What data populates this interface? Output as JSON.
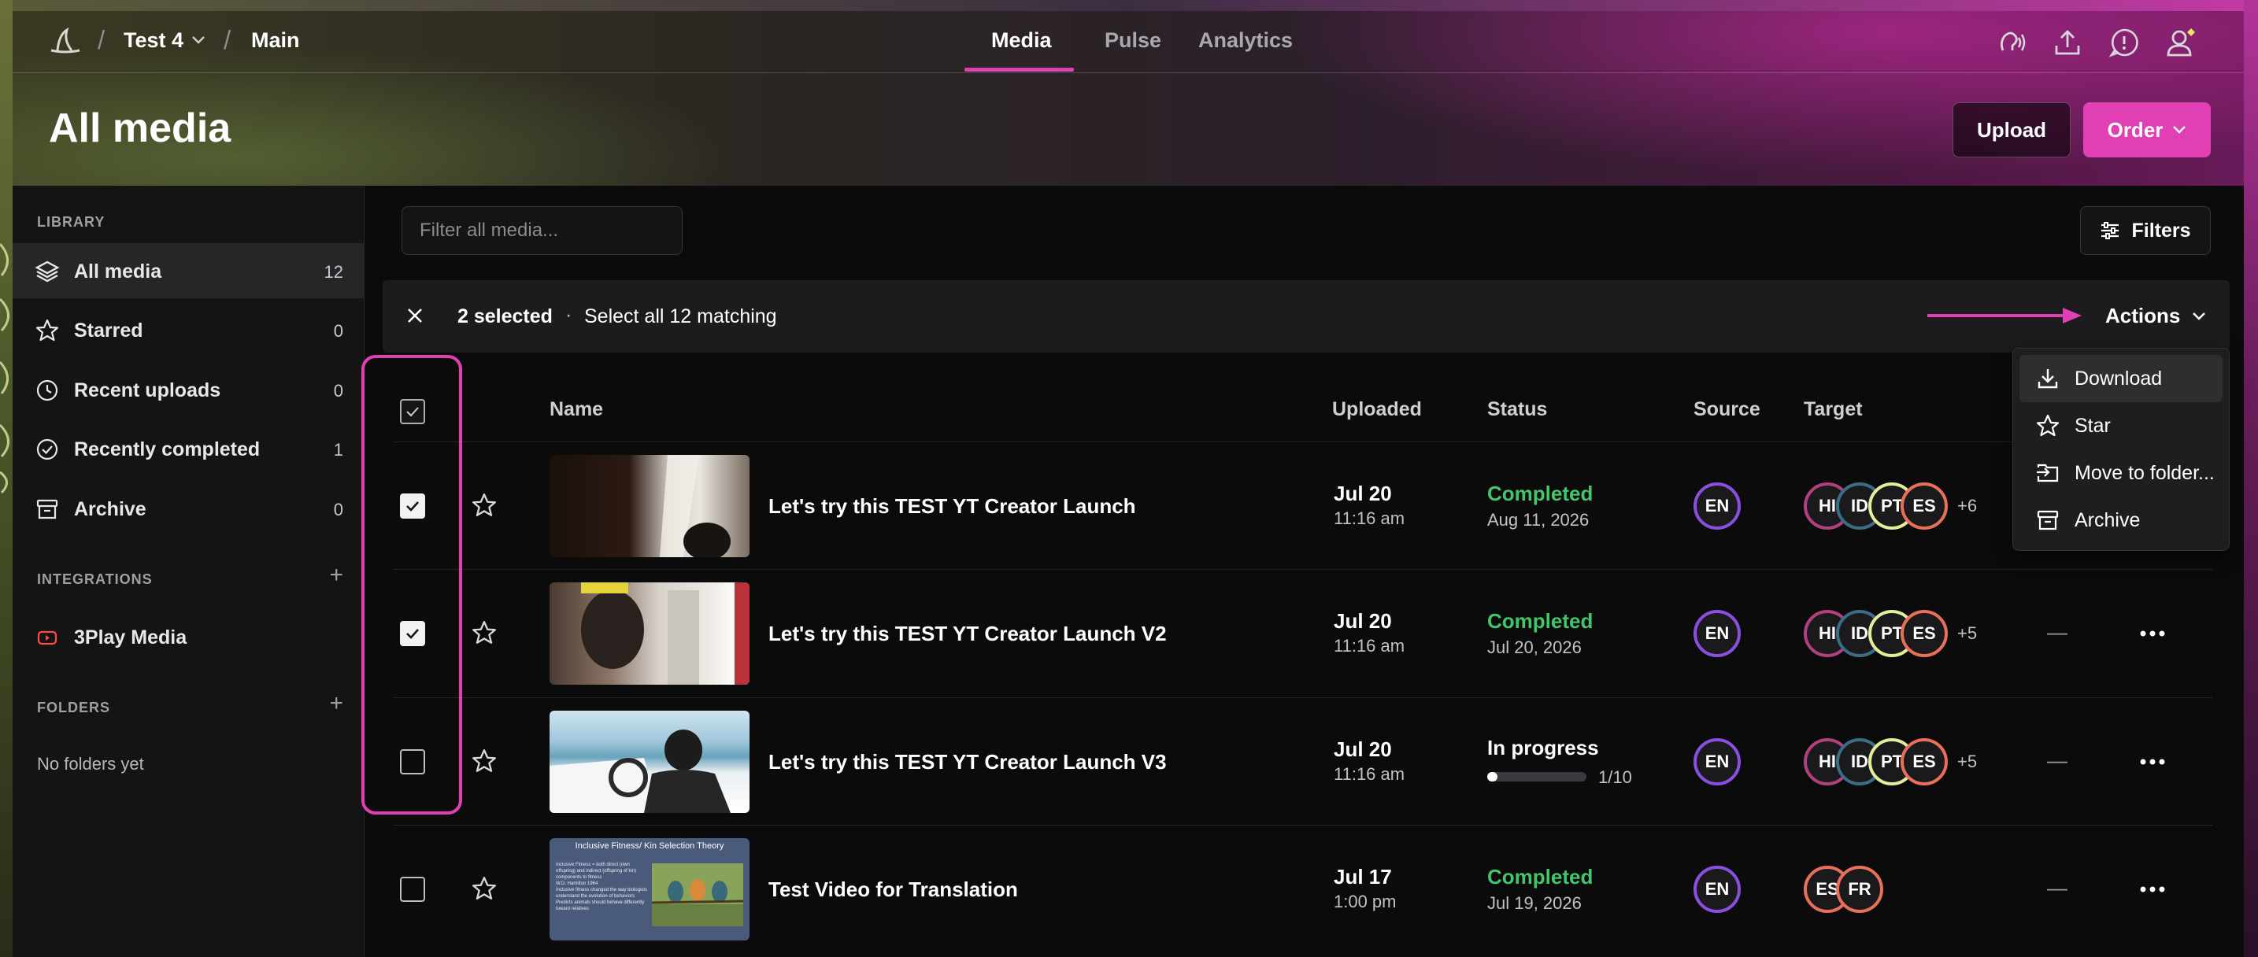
{
  "breadcrumb": {
    "project": "Test 4",
    "workspace": "Main"
  },
  "nav_tabs": [
    {
      "label": "Media",
      "active": true
    },
    {
      "label": "Pulse",
      "active": false
    },
    {
      "label": "Analytics",
      "active": false
    }
  ],
  "header": {
    "title": "All media",
    "upload_label": "Upload",
    "order_label": "Order"
  },
  "sidebar": {
    "library_heading": "LIBRARY",
    "items": [
      {
        "label": "All media",
        "count": "12",
        "icon": "layers-icon",
        "active": true
      },
      {
        "label": "Starred",
        "count": "0",
        "icon": "star-icon"
      },
      {
        "label": "Recent uploads",
        "count": "0",
        "icon": "clock-icon"
      },
      {
        "label": "Recently completed",
        "count": "1",
        "icon": "check-circle-icon"
      },
      {
        "label": "Archive",
        "count": "0",
        "icon": "archive-icon"
      }
    ],
    "integrations_heading": "INTEGRATIONS",
    "integrations": [
      {
        "label": "3Play Media",
        "icon": "youtube-icon"
      }
    ],
    "folders_heading": "FOLDERS",
    "folders_empty": "No folders yet"
  },
  "filter": {
    "placeholder": "Filter all media...",
    "filters_label": "Filters"
  },
  "selection": {
    "count_label": "2 selected",
    "separator": "·",
    "select_all_label": "Select all 12 matching",
    "actions_label": "Actions"
  },
  "table": {
    "columns": {
      "name": "Name",
      "uploaded": "Uploaded",
      "status": "Status",
      "source": "Source",
      "target": "Target"
    },
    "rows": [
      {
        "checked": true,
        "name": "Let's try this TEST YT Creator Launch",
        "date": "Jul 20",
        "time": "11:16 am",
        "status": "Completed",
        "status_sub": "Aug 11, 2026",
        "source": "EN",
        "targets": [
          "HI",
          "ID",
          "PT",
          "ES"
        ],
        "more": "+6",
        "dash": "",
        "progress": null
      },
      {
        "checked": true,
        "name": "Let's try this TEST YT Creator Launch V2",
        "date": "Jul 20",
        "time": "11:16 am",
        "status": "Completed",
        "status_sub": "Jul 20, 2026",
        "source": "EN",
        "targets": [
          "HI",
          "ID",
          "PT",
          "ES"
        ],
        "more": "+5",
        "dash": "—",
        "progress": null
      },
      {
        "checked": false,
        "name": "Let's try this TEST YT Creator Launch V3",
        "date": "Jul 20",
        "time": "11:16 am",
        "status": "In progress",
        "status_sub": "1/10",
        "source": "EN",
        "targets": [
          "HI",
          "ID",
          "PT",
          "ES"
        ],
        "more": "+5",
        "dash": "—",
        "progress": 0.1
      },
      {
        "checked": false,
        "name": "Test Video for Translation",
        "date": "Jul 17",
        "time": "1:00 pm",
        "status": "Completed",
        "status_sub": "Jul 19, 2026",
        "source": "EN",
        "targets": [
          "ES",
          "FR"
        ],
        "more": "",
        "dash": "—",
        "progress": null
      }
    ],
    "slide_thumb": {
      "title": "Inclusive Fitness/ Kin Selection Theory",
      "bullets": [
        "Inclusive Fitness = both direct (own offspring) and indirect (offspring of kin) components to fitness",
        "W.D. Hamilton 1964",
        "Inclusive fitness changed the way biologists understand the evolution of behaviors",
        "Predicts animals should behave differently toward relatives"
      ]
    }
  },
  "actions_menu": [
    {
      "label": "Download",
      "icon": "download-icon"
    },
    {
      "label": "Star",
      "icon": "star-icon"
    },
    {
      "label": "Move to folder...",
      "icon": "move-folder-icon"
    },
    {
      "label": "Archive",
      "icon": "archive-icon"
    }
  ],
  "colors": {
    "accent": "#e13fb4",
    "completed": "#44c56a",
    "badge_EN": "#8a4fe0",
    "badge_HI": "#b0407e",
    "badge_ID": "#3c6d86",
    "badge_PT": "#e7ec9a",
    "badge_ES": "#e8705a",
    "badge_FR": "#e8705a"
  }
}
